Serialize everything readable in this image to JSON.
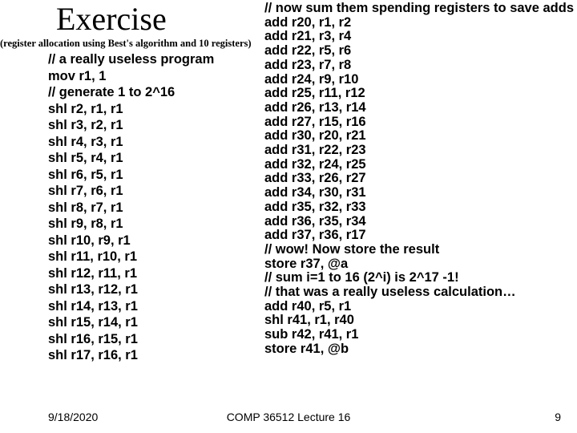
{
  "title": "Exercise",
  "subtitle": "(register allocation using Best's algorithm and 10 registers)",
  "left_code": "// a really useless program\nmov r1, 1\n// generate 1 to 2^16\nshl r2, r1, r1\nshl r3, r2, r1\nshl r4, r3, r1\nshl r5, r4, r1\nshl r6, r5, r1\nshl r7, r6, r1\nshl r8, r7, r1\nshl r9, r8, r1\nshl r10, r9, r1\nshl r11, r10, r1\nshl r12, r11, r1\nshl r13, r12, r1\nshl r14, r13, r1\nshl r15, r14, r1\nshl r16, r15, r1\nshl r17, r16, r1",
  "right_code": "// now sum them spending registers to save adds\nadd r20, r1, r2\nadd r21, r3, r4\nadd r22, r5, r6\nadd r23, r7, r8\nadd r24, r9, r10\nadd r25, r11, r12\nadd r26, r13, r14\nadd r27, r15, r16\nadd r30, r20, r21\nadd r31, r22, r23\nadd r32, r24, r25\nadd r33, r26, r27\nadd r34, r30, r31\nadd r35, r32, r33\nadd r36, r35, r34\nadd r37, r36, r17\n// wow! Now store the result\nstore r37, @a\n// sum i=1 to 16 (2^i) is 2^17 -1!\n// that was a really useless calculation…\nadd r40, r5, r1\nshl r41, r1, r40\nsub r42, r41, r1\nstore r41, @b",
  "footer": {
    "date": "9/18/2020",
    "center": "COMP 36512 Lecture 16",
    "page": "9"
  }
}
